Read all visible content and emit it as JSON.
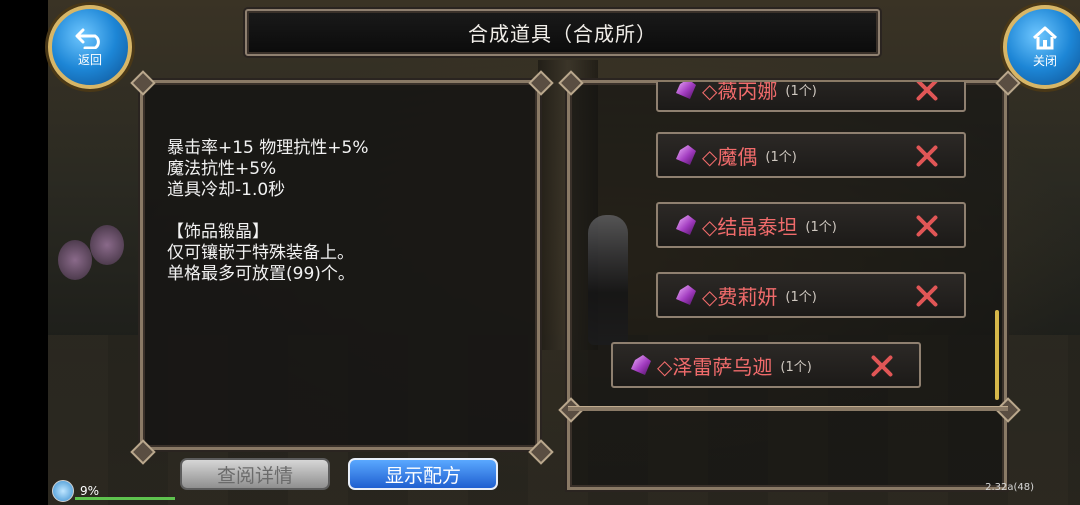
{
  "header": {
    "title": "合成道具（合成所）",
    "back_label": "返回",
    "close_label": "关闭"
  },
  "description": {
    "text": "暴击率+15 物理抗性+5%\n魔法抗性+5%\n道具冷却-1.0秒\n\n【饰品锻晶】\n仅可镶嵌于特殊装备上。\n单格最多可放置(99)个。"
  },
  "materials": [
    {
      "name": "◇薇丙娜",
      "qty": "(1个)"
    },
    {
      "name": "◇魔偶",
      "qty": "(1个)"
    },
    {
      "name": "◇结晶泰坦",
      "qty": "(1个)"
    },
    {
      "name": "◇费莉妍",
      "qty": "(1个)"
    },
    {
      "name": "◇泽雷萨乌迦",
      "qty": "(1个)"
    }
  ],
  "buttons": {
    "details_label": "查阅详情",
    "recipe_label": "显示配方"
  },
  "status": {
    "battery_percent": "9%",
    "version": "2.32a(48)"
  },
  "colors": {
    "item_name": "#f06b6b",
    "delete_x": "#e15656",
    "recipe_button": "#1f5fd0",
    "frame": "#8f8070"
  },
  "icons": {
    "back": "return-arrow-icon",
    "close": "house-icon",
    "gem": "purple-crystal-icon",
    "delete": "x-icon"
  }
}
